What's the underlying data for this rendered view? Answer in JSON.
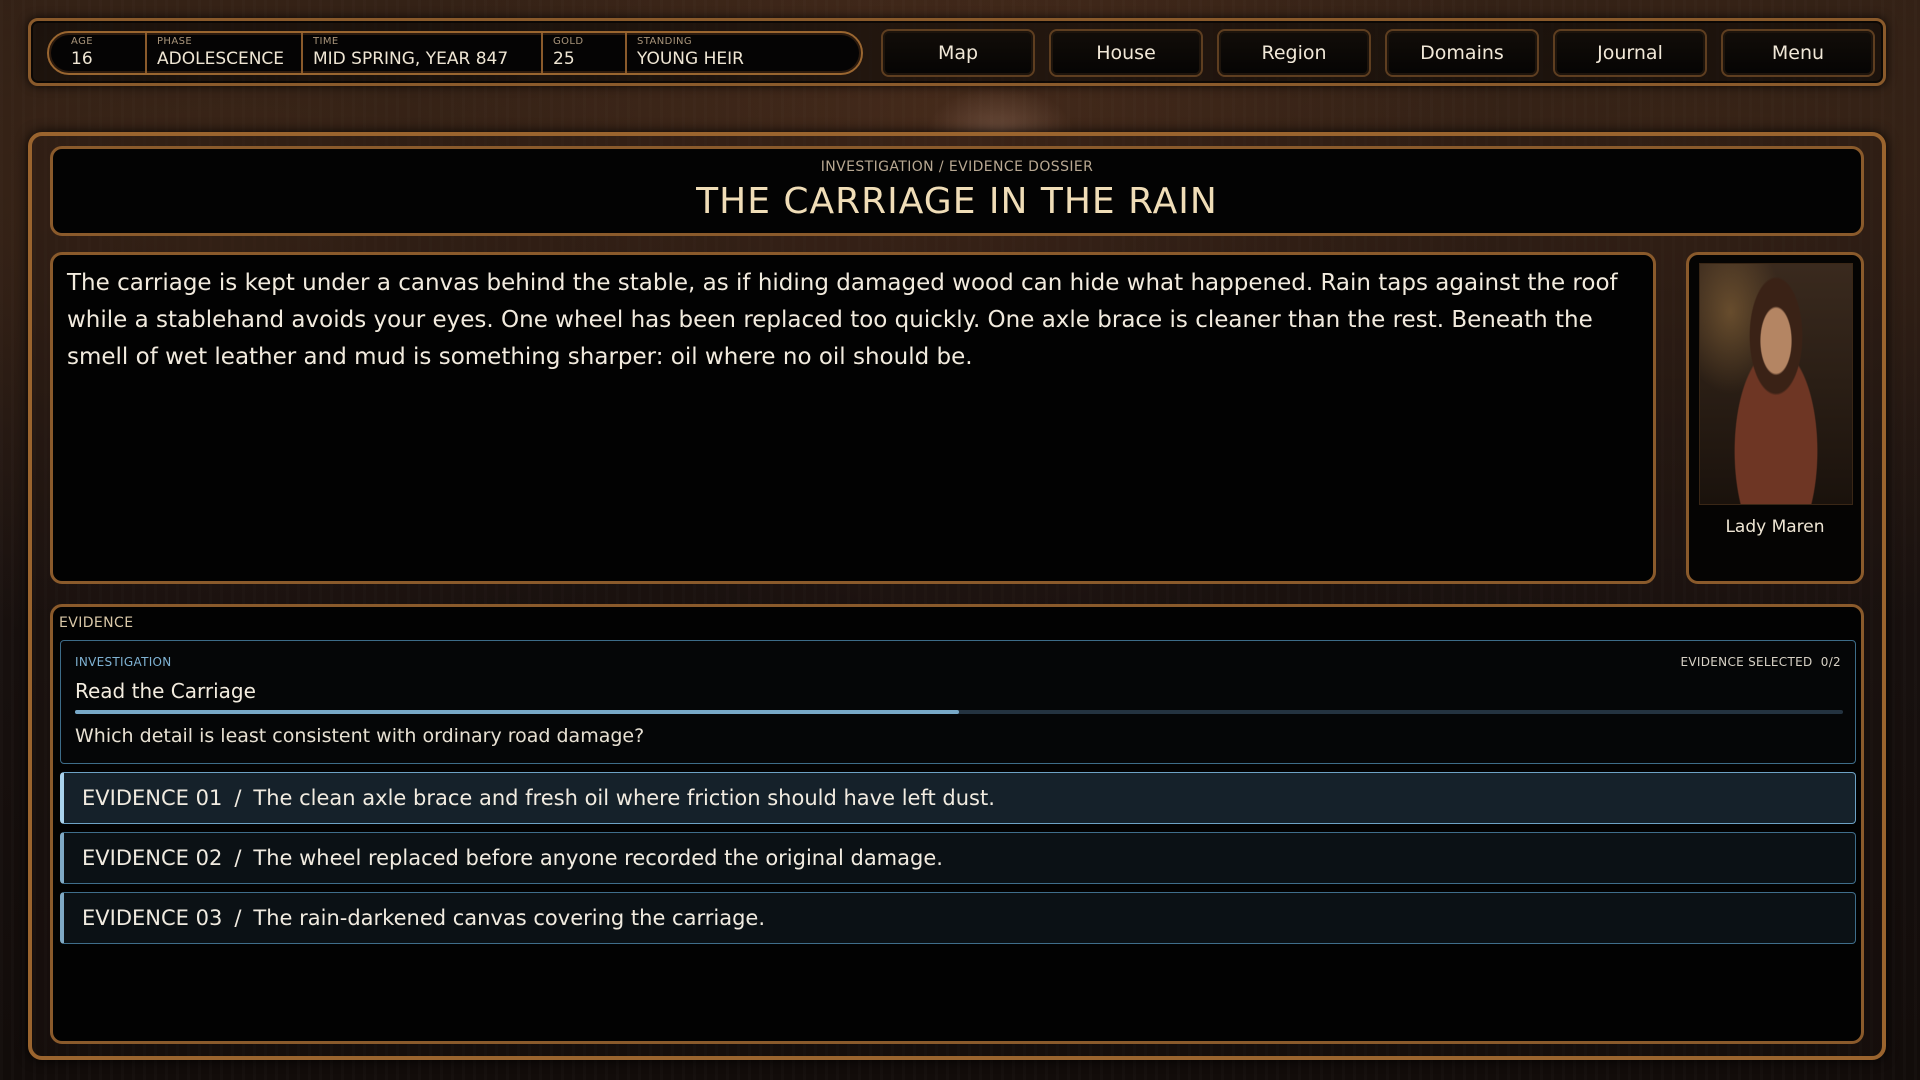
{
  "hud": {
    "stats": [
      {
        "label": "AGE",
        "value": "16"
      },
      {
        "label": "PHASE",
        "value": "ADOLESCENCE"
      },
      {
        "label": "TIME",
        "value": "MID SPRING, YEAR 847"
      },
      {
        "label": "GOLD",
        "value": "25"
      },
      {
        "label": "STANDING",
        "value": "YOUNG HEIR"
      }
    ],
    "nav": [
      "Map",
      "House",
      "Region",
      "Domains",
      "Journal",
      "Menu"
    ]
  },
  "dossier": {
    "subtitle": "INVESTIGATION / EVIDENCE DOSSIER",
    "title": "THE CARRIAGE IN THE RAIN"
  },
  "narrative": "The carriage is kept under a canvas behind the stable, as if hiding damaged wood can hide what happened. Rain taps against the roof while a stablehand avoids your eyes. One wheel has been replaced too quickly. One axle brace is cleaner than the rest. Beneath the smell of wet leather and mud is something sharper: oil where no oil should be.",
  "portrait": {
    "name": "Lady Maren"
  },
  "evidence": {
    "section_label": "EVIDENCE",
    "card": {
      "tag": "INVESTIGATION",
      "selected_label": "EVIDENCE SELECTED",
      "selected_count": "0/2",
      "title": "Read the Carriage",
      "progress": 0.5,
      "question": "Which detail is least consistent with ordinary road damage?"
    },
    "items": [
      {
        "id": "EVIDENCE 01",
        "text": "The clean axle brace and fresh oil where friction should have left dust."
      },
      {
        "id": "EVIDENCE 02",
        "text": "The wheel replaced before anyone recorded the original damage."
      },
      {
        "id": "EVIDENCE 03",
        "text": "The rain-darkened canvas covering the carriage."
      }
    ]
  }
}
